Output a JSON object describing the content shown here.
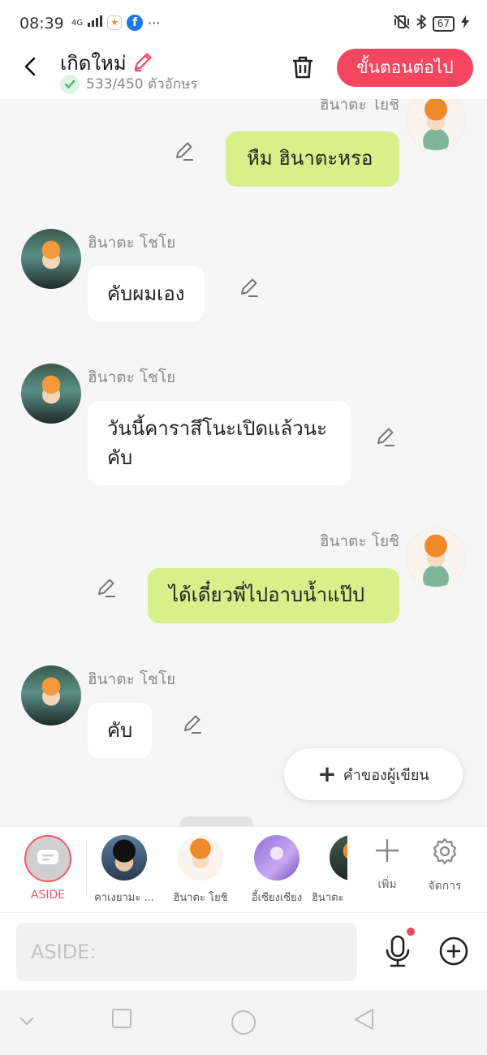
{
  "status_bar": {
    "time": "08:39",
    "network": "4G",
    "battery": "67"
  },
  "header": {
    "title": "เกิดใหม่",
    "char_count": "533/450 ตัวอักษร",
    "next_label": "ขั้นตอนต่อไป"
  },
  "messages": [
    {
      "name": "ฮินาตะ โยชิ",
      "text": "หืม ฮินาตะหรอ",
      "side": "right"
    },
    {
      "name": "ฮินาตะ โชโย",
      "text": "คับผมเอง",
      "side": "left"
    },
    {
      "name": "ฮินาตะ โชโย",
      "text": "วันนี้คาราสึโนะเปิดแล้วนะคับ",
      "side": "left"
    },
    {
      "name": "ฮินาตะ โยชิ",
      "text": "ได้เดี๋ยวพี่ไปอาบน้ำแป๊ป",
      "side": "right"
    },
    {
      "name": "ฮินาตะ โชโย",
      "text": "คับ",
      "side": "left"
    }
  ],
  "floating_button": {
    "label": "คำของผู้เขียน"
  },
  "characters": {
    "aside": "ASIDE",
    "items": [
      "คาเงยามะ ...",
      "ฮินาตะ โยชิ",
      "อี้เซียงเซียง",
      "ฮินาตะ"
    ],
    "add_label": "เพิ่ม",
    "manage_label": "จัดการ"
  },
  "input": {
    "placeholder": "ASIDE:"
  },
  "colors": {
    "accent": "#f4465e",
    "green_bubble": "#d7f08a",
    "white_bubble": "#ffffff"
  }
}
